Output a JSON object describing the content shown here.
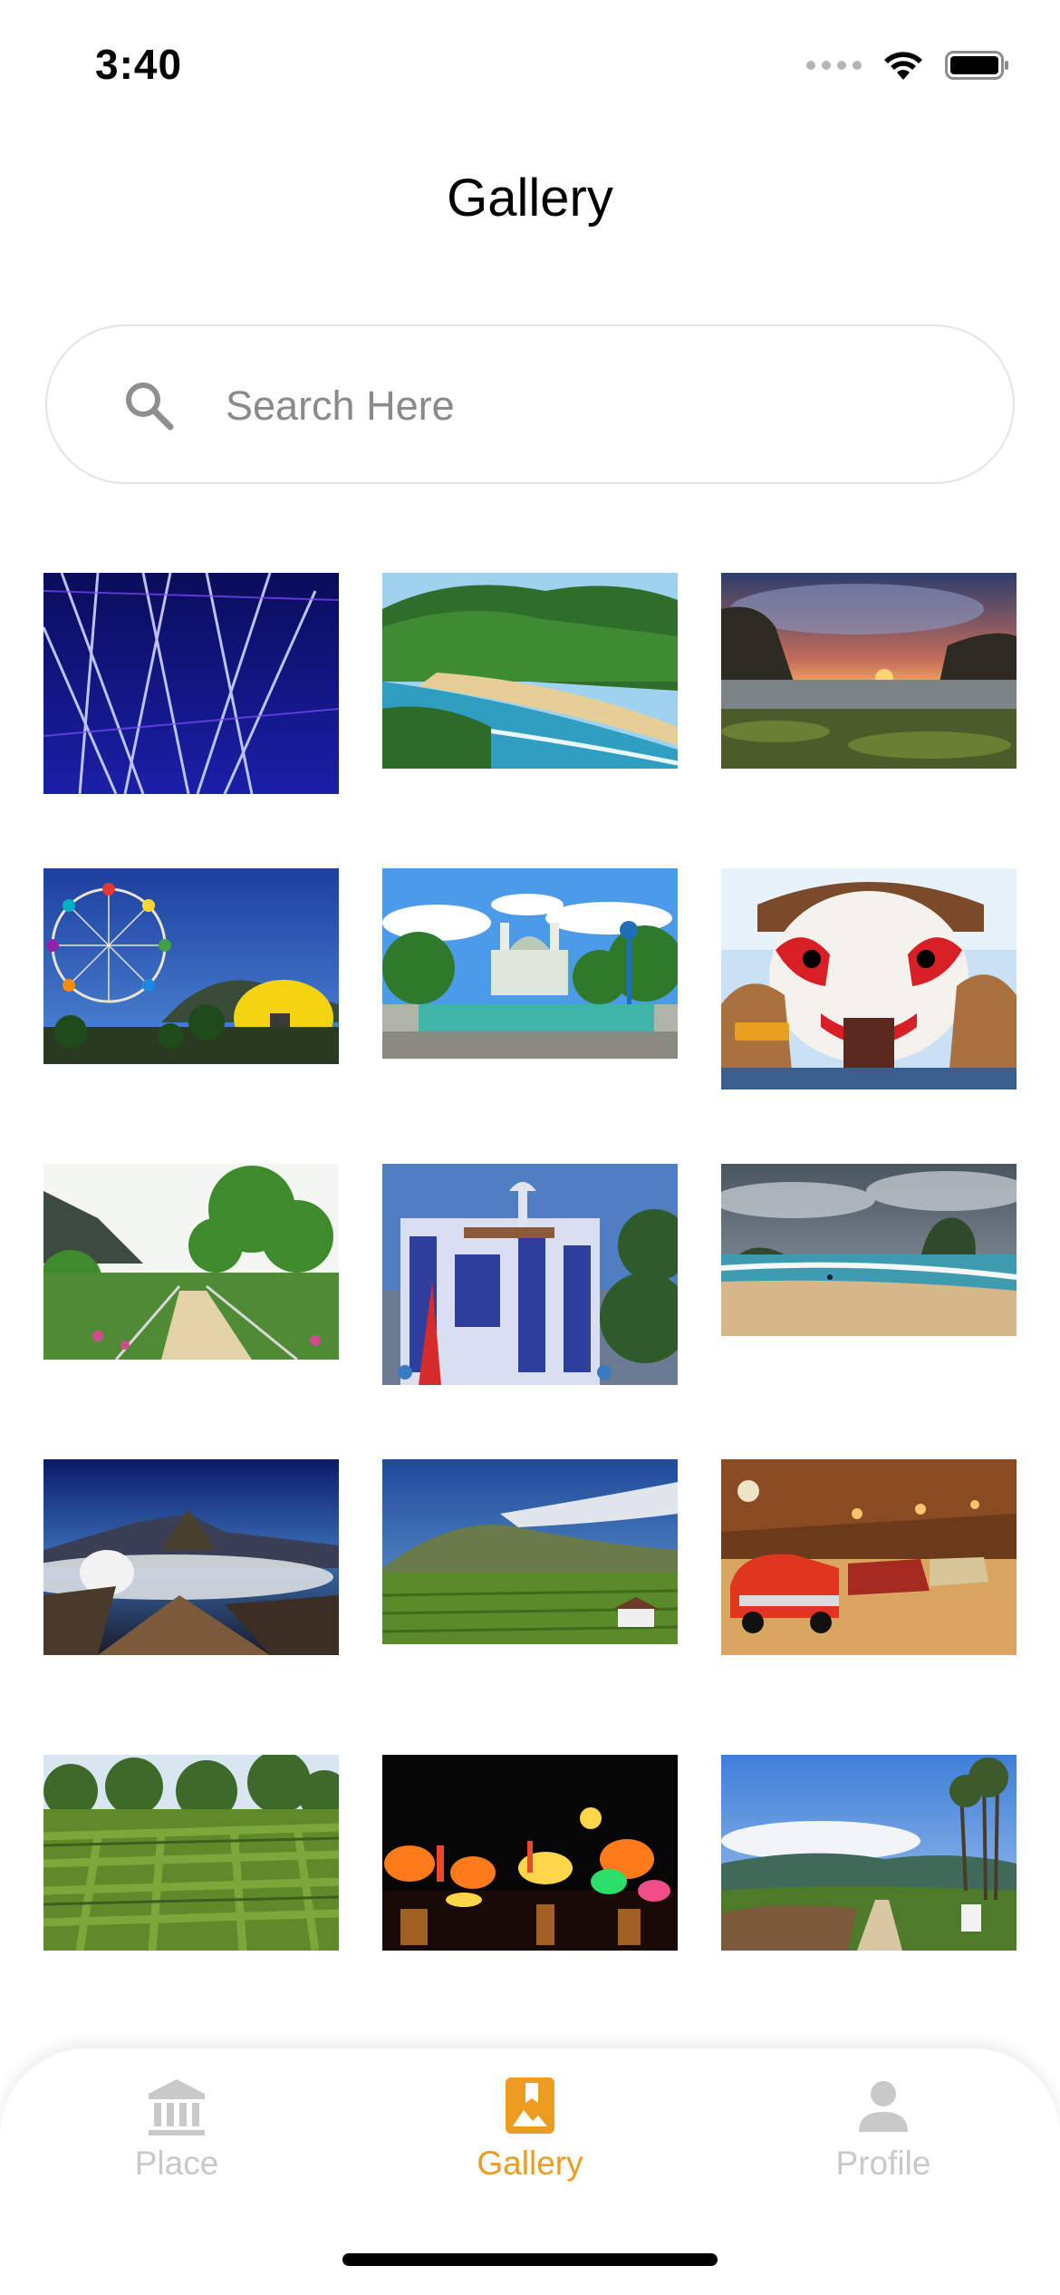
{
  "status_bar": {
    "time": "3:40"
  },
  "header": {
    "title": "Gallery"
  },
  "search": {
    "placeholder": "Search Here",
    "value": ""
  },
  "gallery": {
    "photos": [
      "laser-light-show",
      "tropical-beach-cove",
      "sunset-rocky-shore",
      "ferris-wheel-park",
      "mosque-with-fountain",
      "giant-clown-mask-entrance",
      "garden-bridge-walkway",
      "ornate-blue-mosque",
      "beach-with-rock-island",
      "volcano-crater-landscape",
      "green-hills-village",
      "vintage-car-museum",
      "hedge-maze-garden",
      "lantern-festival-night",
      "hilltop-viewpoint-path"
    ]
  },
  "tabs": [
    {
      "label": "Place",
      "icon": "museum-icon",
      "active": false
    },
    {
      "label": "Gallery",
      "icon": "photo-bookmark-icon",
      "active": true
    },
    {
      "label": "Profile",
      "icon": "person-icon",
      "active": false
    }
  ],
  "colors": {
    "accent": "#EE9B22",
    "inactive": "#C9C9C9"
  }
}
